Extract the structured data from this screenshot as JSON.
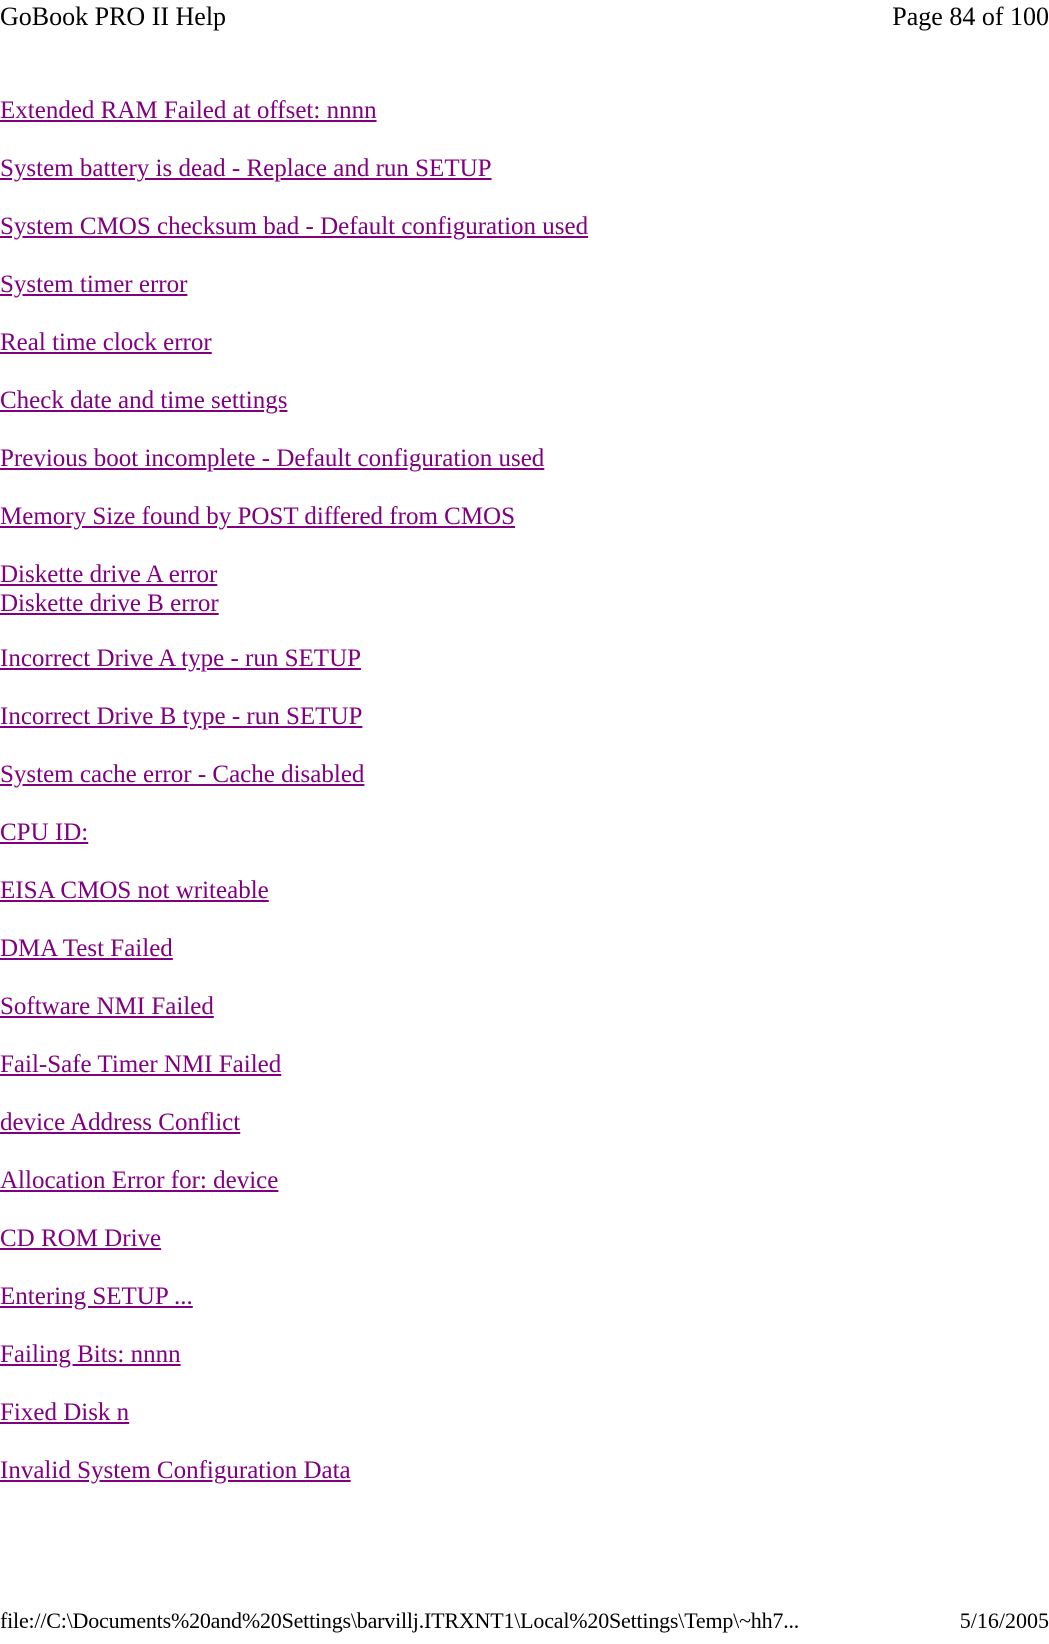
{
  "header": {
    "title": "GoBook PRO II Help",
    "page_label": "Page 84 of 100"
  },
  "theme": {
    "link_color": "#800080",
    "text_color": "#000000",
    "background": "#ffffff"
  },
  "main": {
    "links": [
      {
        "label": "Extended RAM Failed at offset: nnnn"
      },
      {
        "label": "System battery is dead - Replace and run SETUP"
      },
      {
        "label": "System CMOS checksum bad - Default configuration used"
      },
      {
        "label": "System timer error"
      },
      {
        "label": "Real time clock error"
      },
      {
        "label": "Check date and time settings"
      },
      {
        "label": "Previous boot incomplete - Default configuration used"
      },
      {
        "label": "Memory Size found by POST differed from CMOS"
      },
      {
        "label": "Diskette drive A error",
        "stacked_with_next": true
      },
      {
        "label": "Diskette drive B error"
      },
      {
        "label": "Incorrect Drive A type - run SETUP"
      },
      {
        "label": "Incorrect Drive B type - run SETUP"
      },
      {
        "label": "System cache error - Cache disabled"
      },
      {
        "label": "CPU ID:"
      },
      {
        "label": "EISA CMOS not writeable"
      },
      {
        "label": "DMA Test Failed"
      },
      {
        "label": "Software NMI Failed"
      },
      {
        "label": "Fail-Safe Timer NMI Failed"
      },
      {
        "label": "device Address Conflict"
      },
      {
        "label": "Allocation Error for: device"
      },
      {
        "label": "CD ROM Drive"
      },
      {
        "label": "Entering SETUP ..."
      },
      {
        "label": "Failing Bits: nnnn"
      },
      {
        "label": "Fixed Disk n"
      },
      {
        "label": "Invalid System Configuration Data"
      }
    ]
  },
  "footer": {
    "path": "file://C:\\Documents%20and%20Settings\\barvillj.ITRXNT1\\Local%20Settings\\Temp\\~hh7...",
    "date": "5/16/2005"
  }
}
